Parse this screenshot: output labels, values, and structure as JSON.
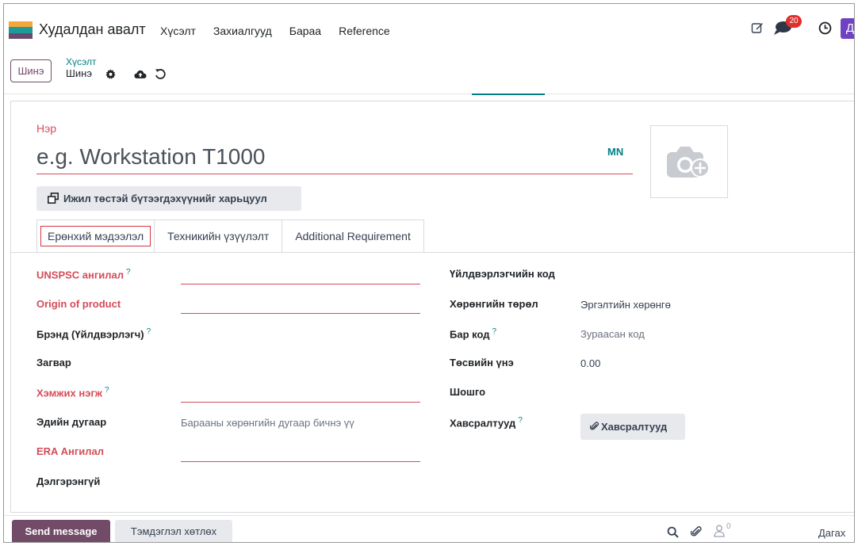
{
  "navbar": {
    "app_title": "Худалдан авалт",
    "menu": [
      "Хүсэлт",
      "Захиалгууд",
      "Бараа",
      "Reference"
    ],
    "message_count": "20",
    "avatar_letter": "Д",
    "logo_colors": [
      "#f3a73a",
      "#1d9a9a",
      "#6a4a6e"
    ]
  },
  "control_panel": {
    "new_button": "Шинэ",
    "breadcrumb_parent": "Хүсэлт",
    "breadcrumb_current": "Шинэ"
  },
  "form": {
    "name_label": "Нэр",
    "name_placeholder": "e.g. Workstation T1000",
    "lang": "MN",
    "compare_button": "Ижил төстэй бүтээгдэхүүнийг харьцуул",
    "tabs": [
      "Ерөнхий мэдээлэл",
      "Техникийн үзүүлэлт",
      "Additional Requirement"
    ],
    "left_fields": [
      {
        "label": "UNSPSC ангилал",
        "help": "?",
        "value": ""
      },
      {
        "label": "Origin of product",
        "help": "",
        "value": ""
      },
      {
        "label": "Брэнд (Үйлдвэрлэгч)",
        "help": "?",
        "value": ""
      },
      {
        "label": "Загвар",
        "help": "",
        "value": ""
      },
      {
        "label": "Хэмжих нэгж",
        "help": "?",
        "value": ""
      },
      {
        "label": "Эдийн дугаар",
        "help": "",
        "value": "Барааны хөрөнгийн дугаар бичнэ үү"
      },
      {
        "label": "ERA Ангилал",
        "help": "",
        "value": ""
      },
      {
        "label": "Дэлгэрэнгүй",
        "help": "",
        "value": ""
      }
    ],
    "right_fields": [
      {
        "label": "Үйлдвэрлэгчийн код",
        "help": "",
        "value": ""
      },
      {
        "label": "Хөрөнгийн төрөл",
        "help": "",
        "value": "Эргэлтийн хөрөнгө"
      },
      {
        "label": "Бар код",
        "help": "?",
        "value": "Зураасан код"
      },
      {
        "label": "Төсвийн үнэ",
        "help": "",
        "value": "0.00"
      },
      {
        "label": "Шошго",
        "help": "",
        "value": ""
      },
      {
        "label": "Хавсралтууд",
        "help": "?",
        "value": ""
      }
    ],
    "attachments_button": "Хавсралтууд"
  },
  "chatter": {
    "send_message": "Send message",
    "log_note": "Тэмдэглэл хөтлөх",
    "follower_count": "0",
    "follow": "Дагах"
  },
  "colors": {
    "primary": "#714b67",
    "accent": "#017e84",
    "required": "#d44c59",
    "badge": "#e0302b"
  }
}
